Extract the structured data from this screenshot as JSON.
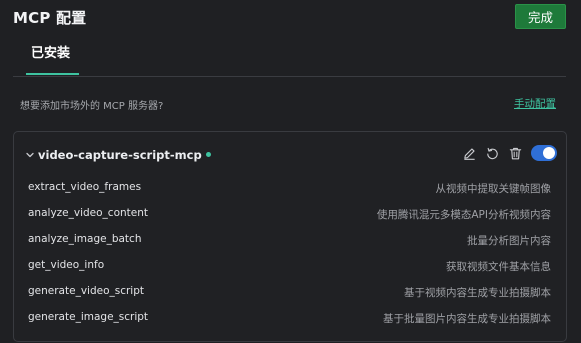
{
  "header": {
    "title": "MCP 配置",
    "done_label": "完成"
  },
  "tabs": [
    {
      "label": "已安装",
      "active": true
    }
  ],
  "hint": {
    "text": "想要添加市场外的 MCP 服务器?",
    "link_label": "手动配置"
  },
  "server": {
    "name": "video-capture-script-mcp",
    "status": "connected",
    "enabled": true,
    "tools": [
      {
        "name": "extract_video_frames",
        "description": "从视频中提取关键帧图像"
      },
      {
        "name": "analyze_video_content",
        "description": "使用腾讯混元多模态API分析视频内容"
      },
      {
        "name": "analyze_image_batch",
        "description": "批量分析图片内容"
      },
      {
        "name": "get_video_info",
        "description": "获取视频文件基本信息"
      },
      {
        "name": "generate_video_script",
        "description": "基于视频内容生成专业拍摄脚本"
      },
      {
        "name": "generate_image_script",
        "description": "基于批量图片内容生成专业拍摄脚本"
      }
    ]
  },
  "colors": {
    "background": "#1f2023",
    "accent": "#3ec3a0",
    "done_button": "#1e7a3a",
    "toggle_on": "#2f6fd6"
  },
  "icons": {
    "collapse": "chevron-down-icon",
    "edit": "pencil-icon",
    "refresh": "refresh-icon",
    "delete": "trash-icon"
  }
}
